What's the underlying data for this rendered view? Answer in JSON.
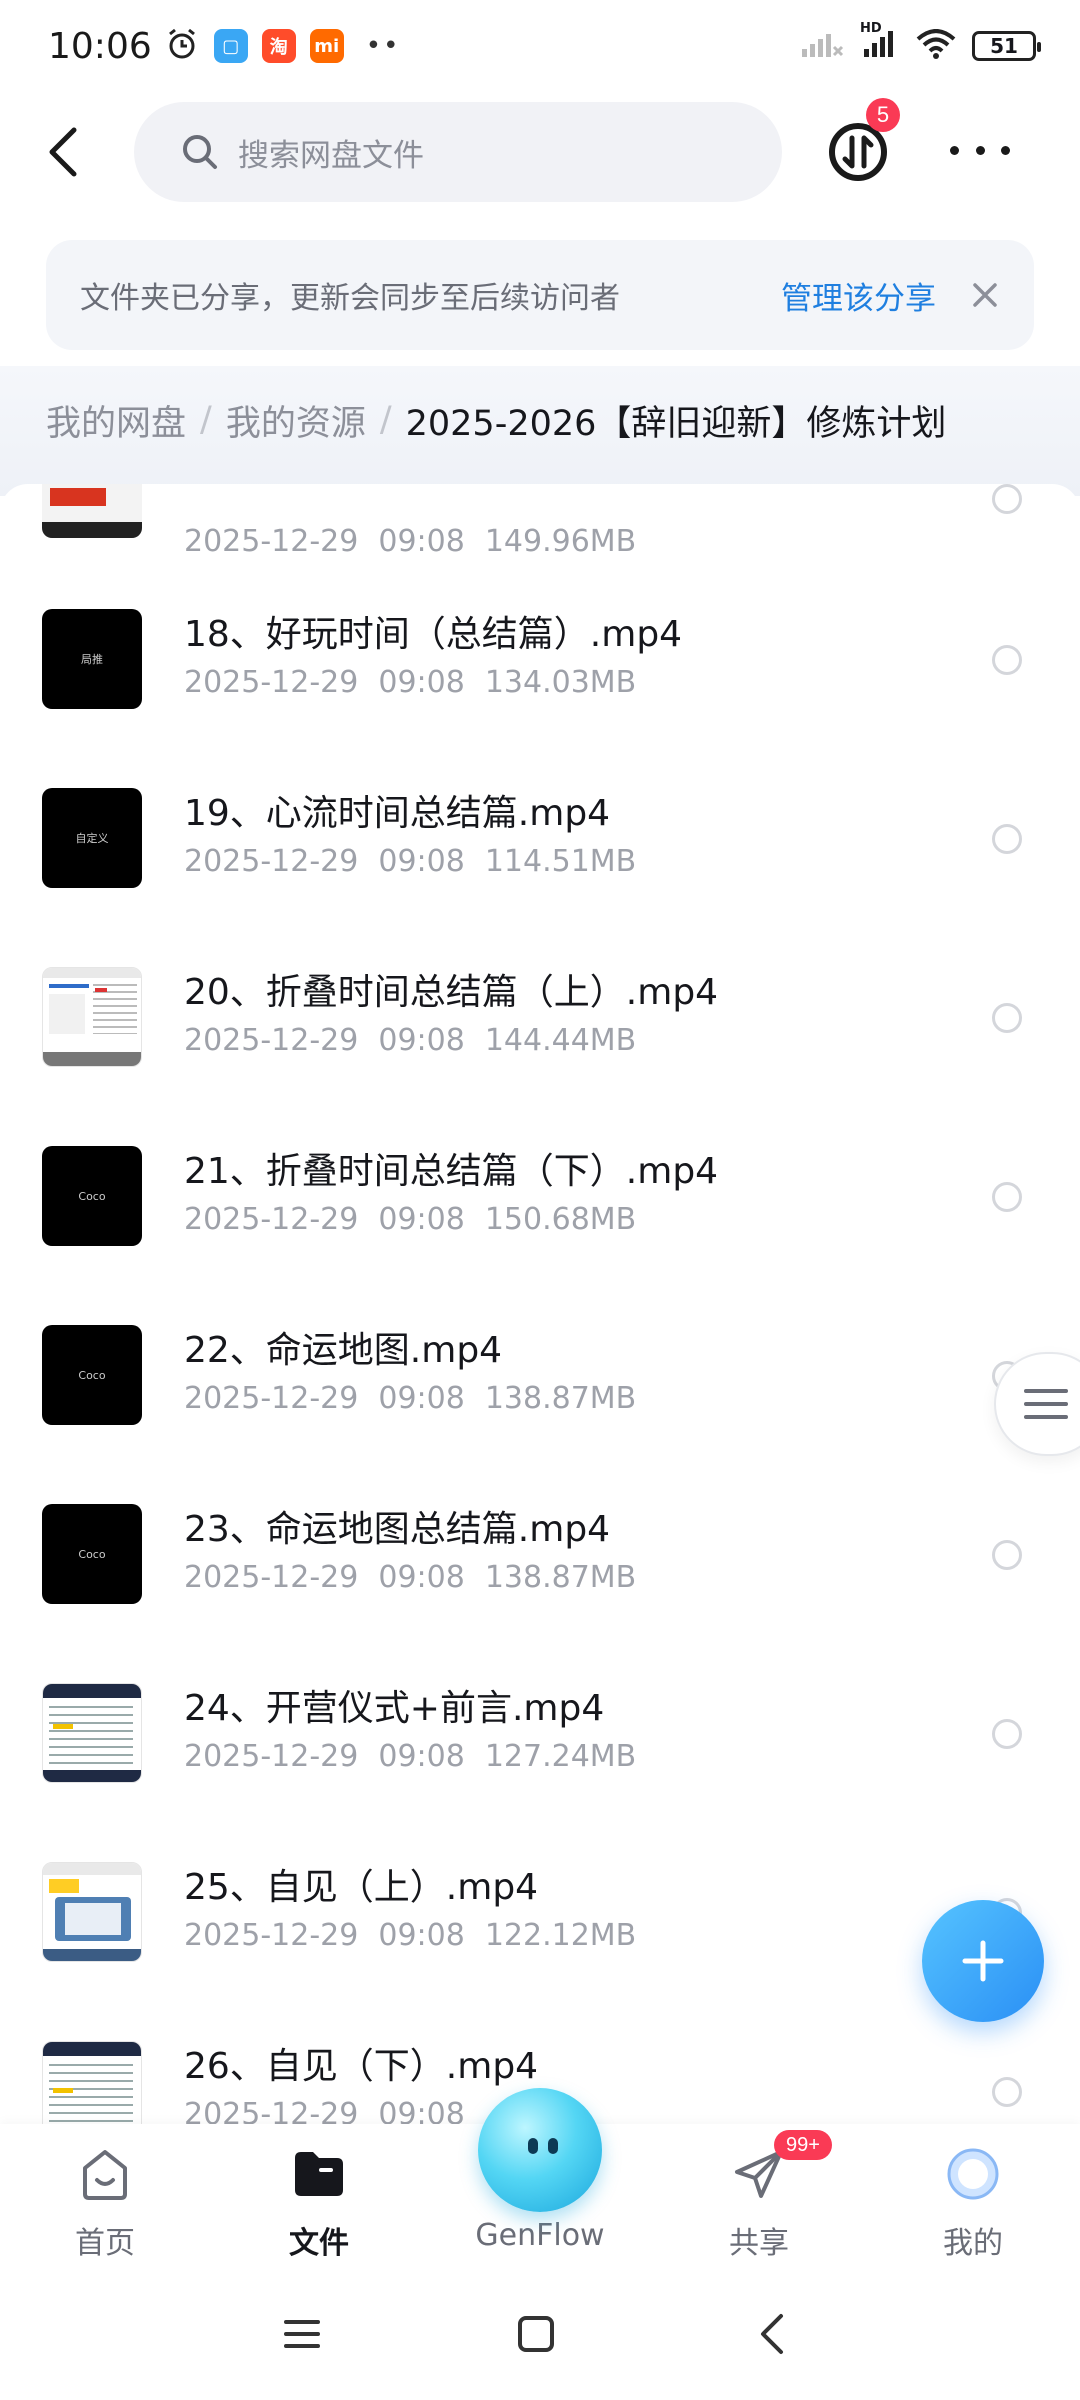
{
  "status": {
    "time": "10:06",
    "battery": "51",
    "net_label": "HD"
  },
  "search": {
    "placeholder": "搜索网盘文件"
  },
  "header": {
    "transfer_badge": "5"
  },
  "notice": {
    "text": "文件夹已分享，更新会同步至后续访问者",
    "link": "管理该分享"
  },
  "breadcrumb": {
    "items": [
      "我的网盘",
      "我的资源"
    ],
    "current": "2025-2026【辞旧迎新】修炼计划"
  },
  "files": [
    {
      "name": "",
      "date": "2025-12-29",
      "time": "09:08",
      "size": "149.96MB",
      "thumb": "slide-red"
    },
    {
      "name": "18、好玩时间（总结篇）.mp4",
      "date": "2025-12-29",
      "time": "09:08",
      "size": "134.03MB",
      "thumb": "black",
      "thumb_text": "局推"
    },
    {
      "name": "19、心流时间总结篇.mp4",
      "date": "2025-12-29",
      "time": "09:08",
      "size": "114.51MB",
      "thumb": "black",
      "thumb_text": "自定义"
    },
    {
      "name": "20、折叠时间总结篇（上）.mp4",
      "date": "2025-12-29",
      "time": "09:08",
      "size": "144.44MB",
      "thumb": "document"
    },
    {
      "name": "21、折叠时间总结篇（下）.mp4",
      "date": "2025-12-29",
      "time": "09:08",
      "size": "150.68MB",
      "thumb": "black",
      "thumb_text": "Coco"
    },
    {
      "name": "22、命运地图.mp4",
      "date": "2025-12-29",
      "time": "09:08",
      "size": "138.87MB",
      "thumb": "black",
      "thumb_text": "Coco"
    },
    {
      "name": "23、命运地图总结篇.mp4",
      "date": "2025-12-29",
      "time": "09:08",
      "size": "138.87MB",
      "thumb": "black",
      "thumb_text": "Coco"
    },
    {
      "name": "24、开营仪式+前言.mp4",
      "date": "2025-12-29",
      "time": "09:08",
      "size": "127.24MB",
      "thumb": "doc-dark"
    },
    {
      "name": "25、自见（上）.mp4",
      "date": "2025-12-29",
      "time": "09:08",
      "size": "122.12MB",
      "thumb": "book"
    },
    {
      "name": "26、自见（下）.mp4",
      "date": "2025-12-29",
      "time": "09:08",
      "size": "",
      "thumb": "doc-dark"
    }
  ],
  "tabs": [
    {
      "label": "首页",
      "icon": "home-icon"
    },
    {
      "label": "文件",
      "icon": "folder-icon",
      "active": true
    },
    {
      "label": "GenFlow",
      "icon": "genflow-orb"
    },
    {
      "label": "共享",
      "icon": "share-icon",
      "badge": "99+"
    },
    {
      "label": "我的",
      "icon": "profile-icon"
    }
  ],
  "colors": {
    "accent": "#1f7fe0",
    "fab": "#2a8ff5",
    "badge": "#fa3a55"
  }
}
